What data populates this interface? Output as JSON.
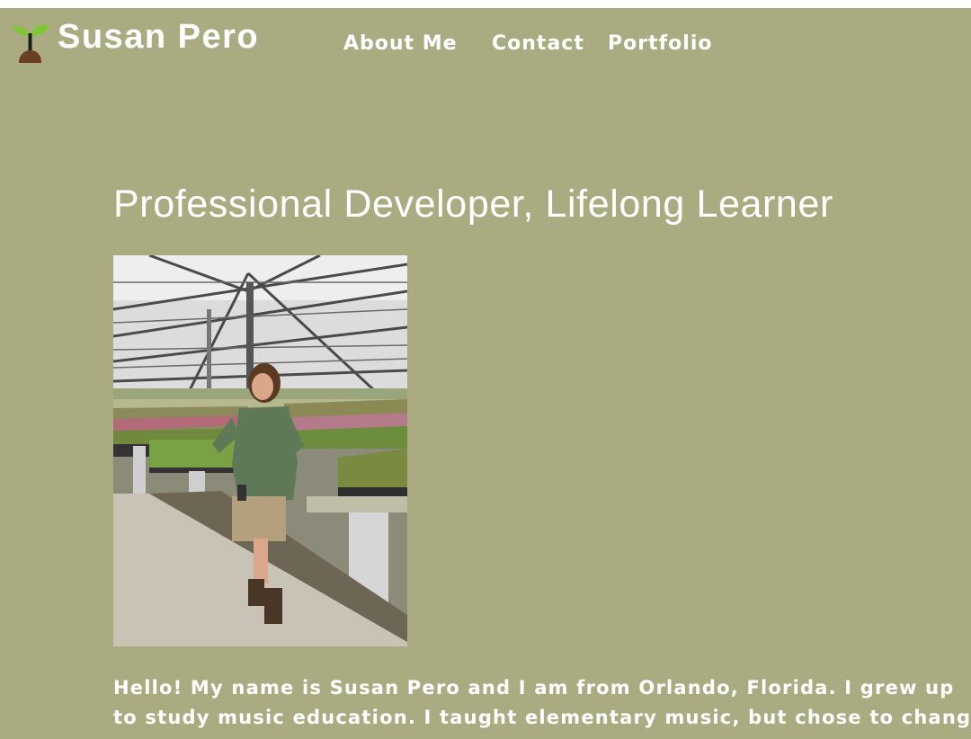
{
  "header": {
    "logo_icon": "sprout-icon",
    "site_title": "Susan Pero"
  },
  "nav": {
    "items": [
      {
        "label": "About Me"
      },
      {
        "label": "Contact"
      },
      {
        "label": "Portfolio"
      }
    ]
  },
  "main": {
    "heading": "Professional Developer, Lifelong Learner",
    "photo_alt": "Susan Pero standing in a greenhouse",
    "bio_lines": [
      "Hello! My name is Susan Pero and I am from Orlando, Florida. I grew up",
      "to study music education. I taught elementary music, but chose to change"
    ]
  },
  "colors": {
    "background": "#abab82",
    "text": "#ffffff",
    "sprout_leaf": "#7cc832",
    "sprout_soil": "#6b3f23"
  }
}
